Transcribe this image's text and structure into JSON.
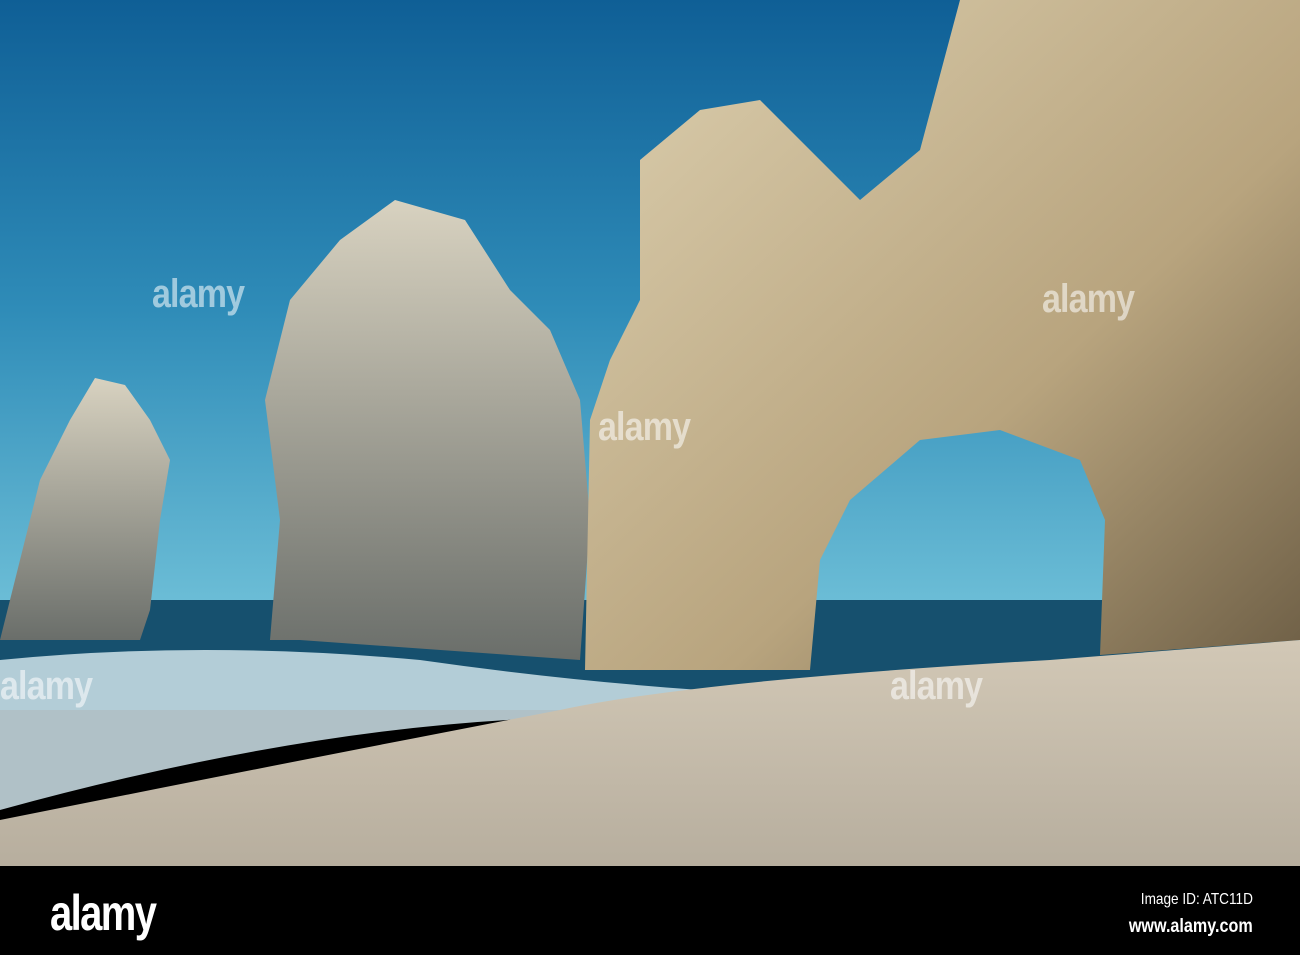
{
  "photo": {
    "subject": "El Arco rock arch at Cabo San Lucas beach",
    "watermark_text": "alamy",
    "colors": {
      "sky_top": "#0f5f96",
      "sky_bottom": "#4aa8c8",
      "rock": "#c9b892",
      "sand": "#c8c0b0",
      "sea": "#16506e"
    }
  },
  "footer": {
    "logo": "alamy",
    "image_id": "Image ID: ATC11D",
    "website": "www.alamy.com"
  }
}
